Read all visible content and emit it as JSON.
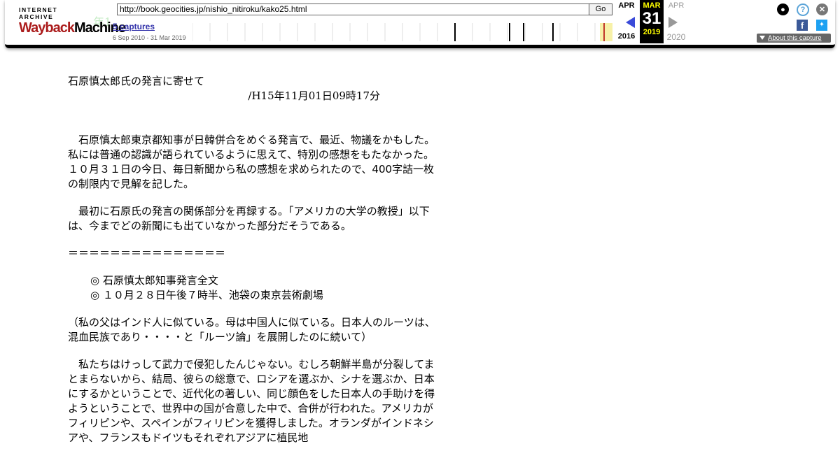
{
  "toolbar": {
    "logo_top": "INTERNET ARCHIVE",
    "logo_main_a": "Wayback",
    "logo_main_b": "Machine",
    "url": "http://book.geocities.jp/nishio_nitiroku/kako25.html",
    "go_label": "Go",
    "captures": "5 captures",
    "range": "6 Sep 2010 - 31 Mar 2019",
    "prev_month": "APR",
    "prev_year": "2016",
    "cur_month": "MAR",
    "cur_day": "31",
    "cur_year": "2019",
    "next_month": "APR",
    "next_year": "2020",
    "about": "About this capture",
    "ghost_text": "年1",
    "colors": {
      "logo_red": "#ab1c1c",
      "prev_arrow": "#3a4ad9",
      "current_bg": "#000000",
      "current_text": "#ffff00"
    }
  },
  "article": {
    "title": "石原慎太郎氏の発言に寄せて",
    "date": "/H15年11月01日09時17分",
    "paragraphs": [
      "石原慎太郎東京都知事が日韓併合をめぐる発言で、最近、物議をかもした。私には普通の認識が語られているように思えて、特別の感想をもたなかった。１０月３１日の今日、毎日新聞から私の感想を求められたので、400字詰一枚の制限内で見解を記した。",
      "最初に石原氏の発言の関係部分を再録する。「アメリカの大学の教授」以下は、今までどの新聞にも出ていなかった部分だそうである。"
    ],
    "separator": "＝＝＝＝＝＝＝＝＝＝＝＝＝＝＝",
    "notice_1": "◎ 石原慎太郎知事発言全文",
    "notice_2": "◎ １０月２８日午後７時半、池袋の東京芸術劇場",
    "paren": "（私の父はインド人に似ている。母は中国人に似ている。日本人のルーツは、混血民族であり・・・・と「ルーツ論」を展開したのに続いて）",
    "speech": "私たちはけっして武力で侵犯したんじゃない。むしろ朝鮮半島が分裂してまとまらないから、結局、彼らの総意で、ロシアを選ぶか、シナを選ぶか、日本にするかということで、近代化の著しい、同じ顔色をした日本人の手助けを得ようということで、世界中の国が合意した中で、合併が行われた。アメリカがフィリピンや、スペインがフィリピンを獲得しました。オランダがインドネシアや、フランスもドイツもそれぞれアジアに植民地"
  }
}
